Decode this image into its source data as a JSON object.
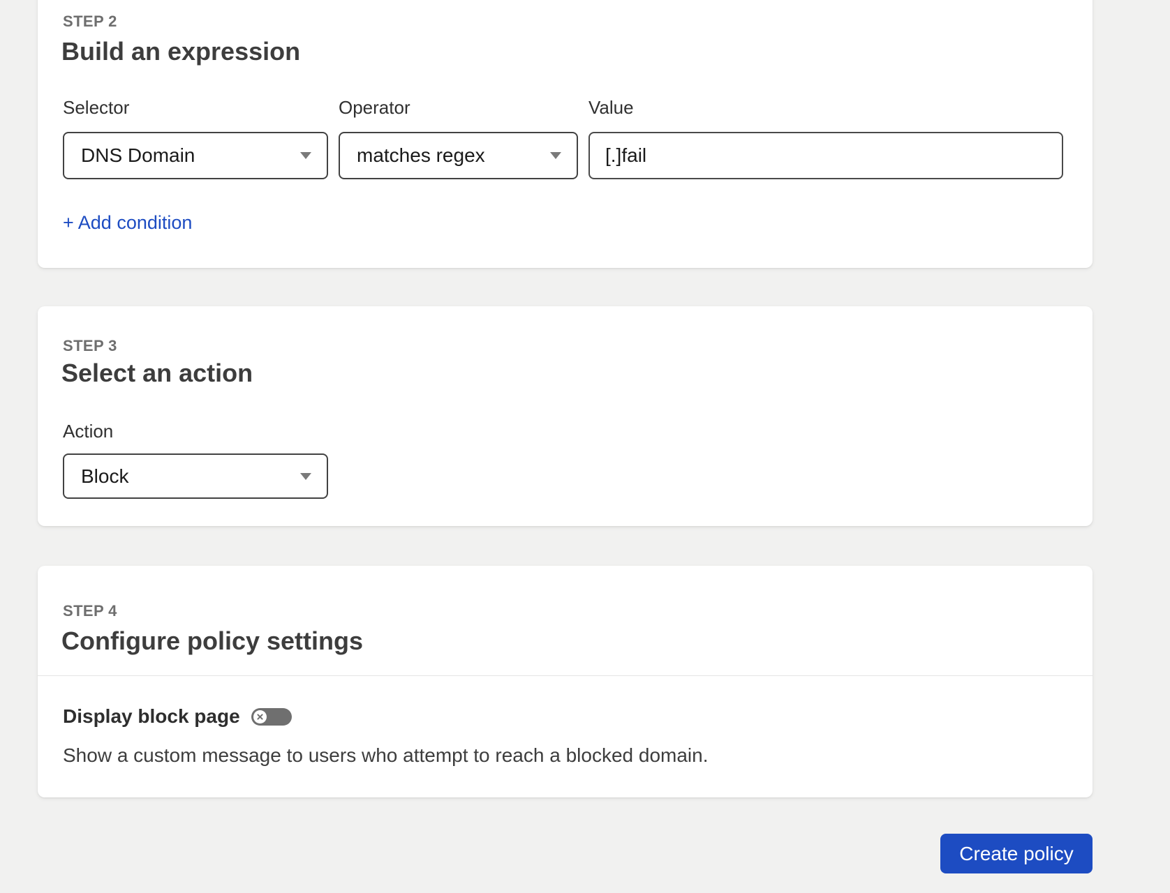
{
  "page": {
    "background_color": "#f1f1f0",
    "accent_blue": "#1d4cc2",
    "card_color": "#ffffff",
    "toggle_off_color": "#6f6f6f"
  },
  "step2": {
    "step_label": "STEP 2",
    "title": "Build an expression",
    "selector": {
      "label": "Selector",
      "value": "DNS Domain",
      "icon": "chevron-down-icon"
    },
    "operator": {
      "label": "Operator",
      "value": "matches regex",
      "icon": "chevron-down-icon"
    },
    "value_field": {
      "label": "Value",
      "value": "[.]fail"
    },
    "add_condition_label": "+ Add condition"
  },
  "step3": {
    "step_label": "STEP 3",
    "title": "Select an action",
    "action": {
      "label": "Action",
      "value": "Block",
      "icon": "chevron-down-icon"
    }
  },
  "step4": {
    "step_label": "STEP 4",
    "title": "Configure policy settings",
    "display_block_page": {
      "label": "Display block page",
      "toggle_state": "off",
      "toggle_icon": "x-circle-icon",
      "description": "Show a custom message to users who attempt to reach a blocked domain."
    }
  },
  "footer": {
    "create_policy_label": "Create policy"
  }
}
